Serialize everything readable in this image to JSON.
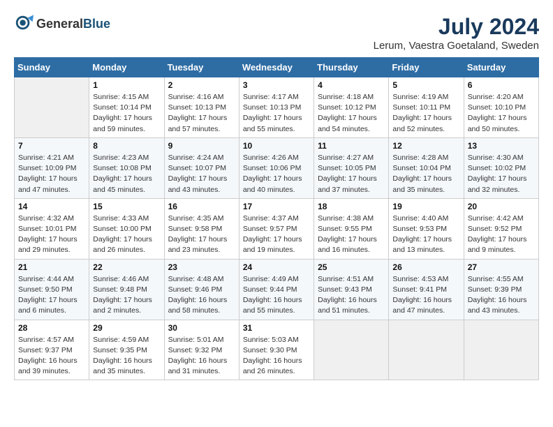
{
  "header": {
    "logo_general": "General",
    "logo_blue": "Blue",
    "month_year": "July 2024",
    "location": "Lerum, Vaestra Goetaland, Sweden"
  },
  "weekdays": [
    "Sunday",
    "Monday",
    "Tuesday",
    "Wednesday",
    "Thursday",
    "Friday",
    "Saturday"
  ],
  "weeks": [
    [
      {
        "day": "",
        "info": ""
      },
      {
        "day": "1",
        "info": "Sunrise: 4:15 AM\nSunset: 10:14 PM\nDaylight: 17 hours\nand 59 minutes."
      },
      {
        "day": "2",
        "info": "Sunrise: 4:16 AM\nSunset: 10:13 PM\nDaylight: 17 hours\nand 57 minutes."
      },
      {
        "day": "3",
        "info": "Sunrise: 4:17 AM\nSunset: 10:13 PM\nDaylight: 17 hours\nand 55 minutes."
      },
      {
        "day": "4",
        "info": "Sunrise: 4:18 AM\nSunset: 10:12 PM\nDaylight: 17 hours\nand 54 minutes."
      },
      {
        "day": "5",
        "info": "Sunrise: 4:19 AM\nSunset: 10:11 PM\nDaylight: 17 hours\nand 52 minutes."
      },
      {
        "day": "6",
        "info": "Sunrise: 4:20 AM\nSunset: 10:10 PM\nDaylight: 17 hours\nand 50 minutes."
      }
    ],
    [
      {
        "day": "7",
        "info": "Sunrise: 4:21 AM\nSunset: 10:09 PM\nDaylight: 17 hours\nand 47 minutes."
      },
      {
        "day": "8",
        "info": "Sunrise: 4:23 AM\nSunset: 10:08 PM\nDaylight: 17 hours\nand 45 minutes."
      },
      {
        "day": "9",
        "info": "Sunrise: 4:24 AM\nSunset: 10:07 PM\nDaylight: 17 hours\nand 43 minutes."
      },
      {
        "day": "10",
        "info": "Sunrise: 4:26 AM\nSunset: 10:06 PM\nDaylight: 17 hours\nand 40 minutes."
      },
      {
        "day": "11",
        "info": "Sunrise: 4:27 AM\nSunset: 10:05 PM\nDaylight: 17 hours\nand 37 minutes."
      },
      {
        "day": "12",
        "info": "Sunrise: 4:28 AM\nSunset: 10:04 PM\nDaylight: 17 hours\nand 35 minutes."
      },
      {
        "day": "13",
        "info": "Sunrise: 4:30 AM\nSunset: 10:02 PM\nDaylight: 17 hours\nand 32 minutes."
      }
    ],
    [
      {
        "day": "14",
        "info": "Sunrise: 4:32 AM\nSunset: 10:01 PM\nDaylight: 17 hours\nand 29 minutes."
      },
      {
        "day": "15",
        "info": "Sunrise: 4:33 AM\nSunset: 10:00 PM\nDaylight: 17 hours\nand 26 minutes."
      },
      {
        "day": "16",
        "info": "Sunrise: 4:35 AM\nSunset: 9:58 PM\nDaylight: 17 hours\nand 23 minutes."
      },
      {
        "day": "17",
        "info": "Sunrise: 4:37 AM\nSunset: 9:57 PM\nDaylight: 17 hours\nand 19 minutes."
      },
      {
        "day": "18",
        "info": "Sunrise: 4:38 AM\nSunset: 9:55 PM\nDaylight: 17 hours\nand 16 minutes."
      },
      {
        "day": "19",
        "info": "Sunrise: 4:40 AM\nSunset: 9:53 PM\nDaylight: 17 hours\nand 13 minutes."
      },
      {
        "day": "20",
        "info": "Sunrise: 4:42 AM\nSunset: 9:52 PM\nDaylight: 17 hours\nand 9 minutes."
      }
    ],
    [
      {
        "day": "21",
        "info": "Sunrise: 4:44 AM\nSunset: 9:50 PM\nDaylight: 17 hours\nand 6 minutes."
      },
      {
        "day": "22",
        "info": "Sunrise: 4:46 AM\nSunset: 9:48 PM\nDaylight: 17 hours\nand 2 minutes."
      },
      {
        "day": "23",
        "info": "Sunrise: 4:48 AM\nSunset: 9:46 PM\nDaylight: 16 hours\nand 58 minutes."
      },
      {
        "day": "24",
        "info": "Sunrise: 4:49 AM\nSunset: 9:44 PM\nDaylight: 16 hours\nand 55 minutes."
      },
      {
        "day": "25",
        "info": "Sunrise: 4:51 AM\nSunset: 9:43 PM\nDaylight: 16 hours\nand 51 minutes."
      },
      {
        "day": "26",
        "info": "Sunrise: 4:53 AM\nSunset: 9:41 PM\nDaylight: 16 hours\nand 47 minutes."
      },
      {
        "day": "27",
        "info": "Sunrise: 4:55 AM\nSunset: 9:39 PM\nDaylight: 16 hours\nand 43 minutes."
      }
    ],
    [
      {
        "day": "28",
        "info": "Sunrise: 4:57 AM\nSunset: 9:37 PM\nDaylight: 16 hours\nand 39 minutes."
      },
      {
        "day": "29",
        "info": "Sunrise: 4:59 AM\nSunset: 9:35 PM\nDaylight: 16 hours\nand 35 minutes."
      },
      {
        "day": "30",
        "info": "Sunrise: 5:01 AM\nSunset: 9:32 PM\nDaylight: 16 hours\nand 31 minutes."
      },
      {
        "day": "31",
        "info": "Sunrise: 5:03 AM\nSunset: 9:30 PM\nDaylight: 16 hours\nand 26 minutes."
      },
      {
        "day": "",
        "info": ""
      },
      {
        "day": "",
        "info": ""
      },
      {
        "day": "",
        "info": ""
      }
    ]
  ]
}
